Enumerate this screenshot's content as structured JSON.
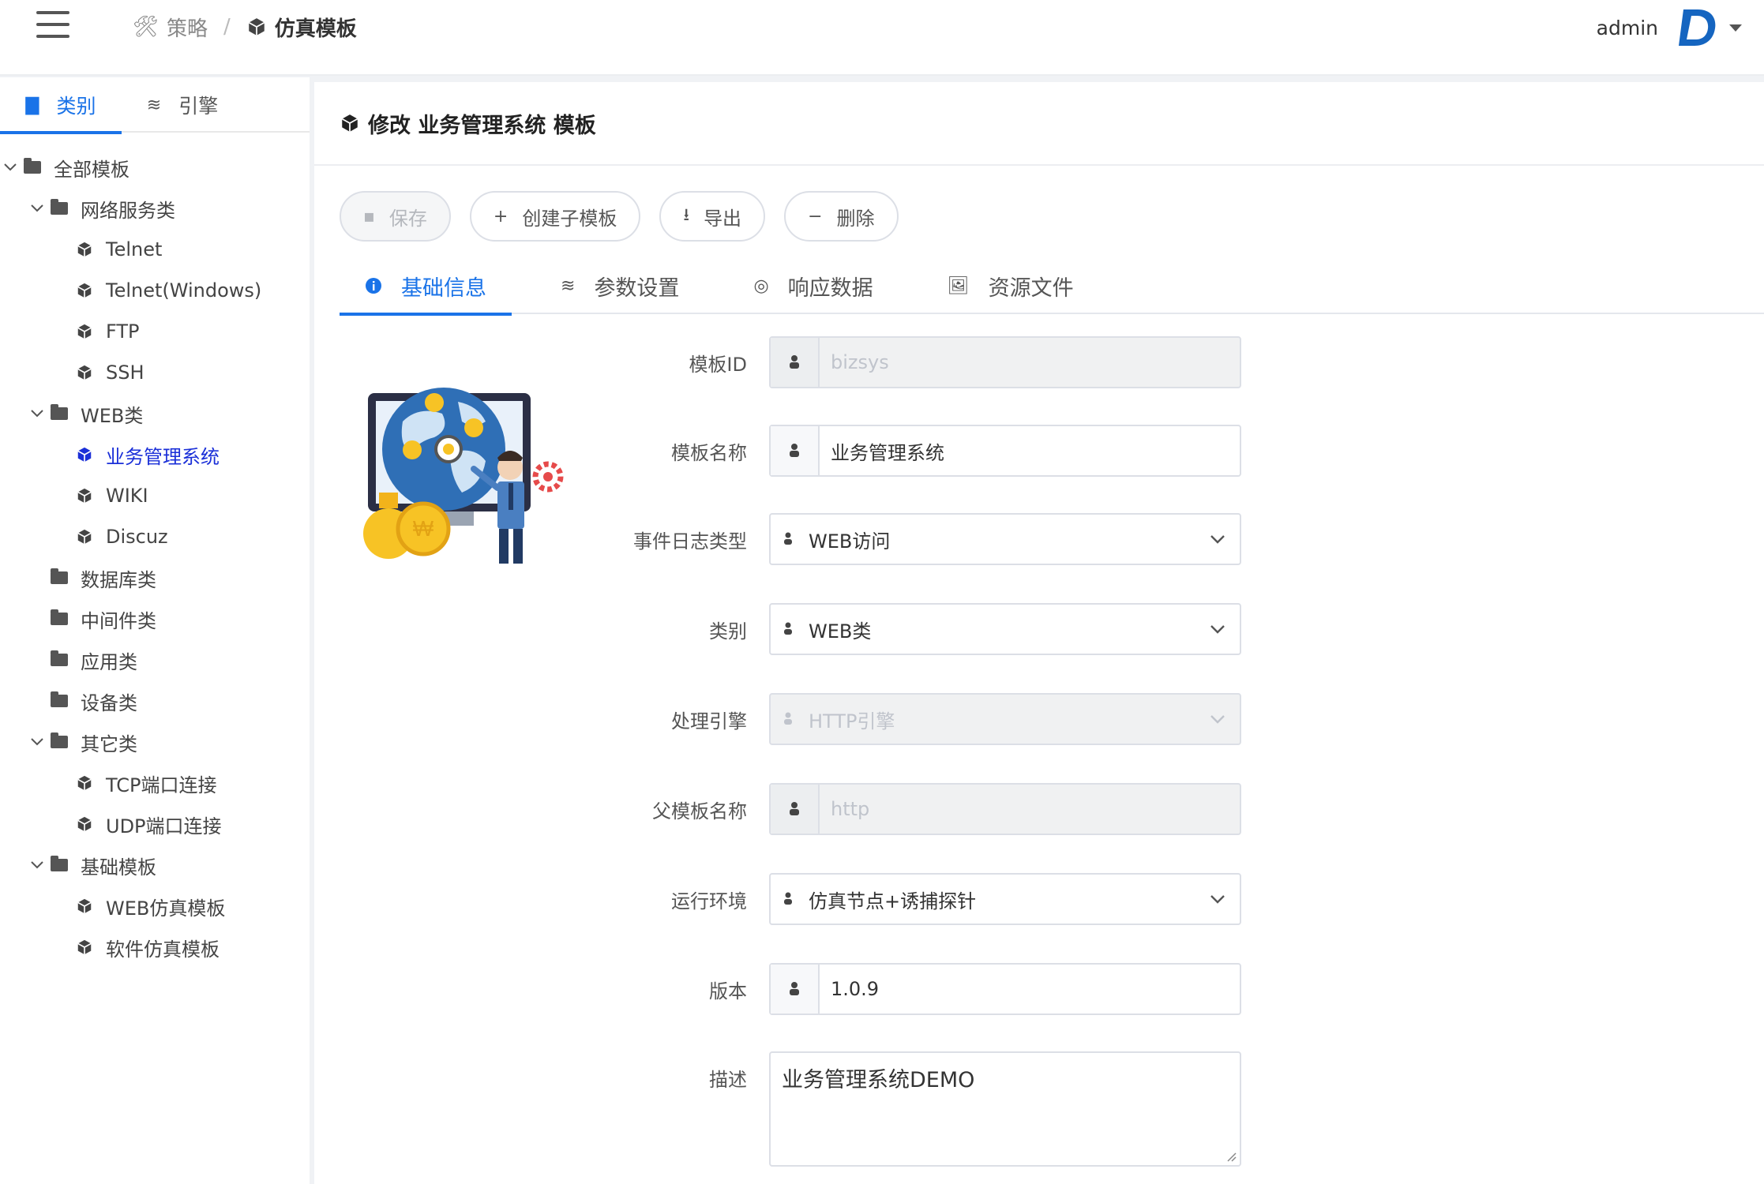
{
  "header": {
    "breadcrumb": [
      {
        "label": "策略",
        "icon": "tools-icon"
      },
      {
        "label": "仿真模板",
        "icon": "cube-icon"
      }
    ],
    "breadcrumb_separator": "/",
    "username": "admin"
  },
  "sidebar": {
    "tabs": [
      {
        "label": "类别",
        "icon": "folder-icon",
        "active": true
      },
      {
        "label": "引擎",
        "icon": "layers-icon",
        "active": false
      }
    ],
    "tree": [
      {
        "label": "全部模板",
        "type": "folder",
        "level": 0,
        "expanded": true
      },
      {
        "label": "网络服务类",
        "type": "folder",
        "level": 1,
        "expanded": true
      },
      {
        "label": "Telnet",
        "type": "item",
        "level": 2
      },
      {
        "label": "Telnet(Windows)",
        "type": "item",
        "level": 2
      },
      {
        "label": "FTP",
        "type": "item",
        "level": 2
      },
      {
        "label": "SSH",
        "type": "item",
        "level": 2
      },
      {
        "label": "WEB类",
        "type": "folder",
        "level": 1,
        "expanded": true
      },
      {
        "label": "业务管理系统",
        "type": "item",
        "level": 2,
        "selected": true
      },
      {
        "label": "WIKI",
        "type": "item",
        "level": 2
      },
      {
        "label": "Discuz",
        "type": "item",
        "level": 2
      },
      {
        "label": "数据库类",
        "type": "folder",
        "level": 1,
        "expanded": false
      },
      {
        "label": "中间件类",
        "type": "folder",
        "level": 1,
        "expanded": false
      },
      {
        "label": "应用类",
        "type": "folder",
        "level": 1,
        "expanded": false
      },
      {
        "label": "设备类",
        "type": "folder",
        "level": 1,
        "expanded": false
      },
      {
        "label": "其它类",
        "type": "folder",
        "level": 1,
        "expanded": true
      },
      {
        "label": "TCP端口连接",
        "type": "item",
        "level": 2
      },
      {
        "label": "UDP端口连接",
        "type": "item",
        "level": 2
      },
      {
        "label": "基础模板",
        "type": "folder",
        "level": 1,
        "expanded": true
      },
      {
        "label": "WEB仿真模板",
        "type": "item",
        "level": 2
      },
      {
        "label": "软件仿真模板",
        "type": "item",
        "level": 2
      }
    ]
  },
  "main": {
    "title": "修改 业务管理系统 模板",
    "toolbar": {
      "save": "保存",
      "create_child": "创建子模板",
      "export": "导出",
      "delete": "删除"
    },
    "tabs": [
      {
        "label": "基础信息",
        "icon": "info-icon",
        "active": true
      },
      {
        "label": "参数设置",
        "icon": "layers-icon",
        "active": false
      },
      {
        "label": "响应数据",
        "icon": "target-icon",
        "active": false
      },
      {
        "label": "资源文件",
        "icon": "image-icon",
        "active": false
      }
    ],
    "form": {
      "template_id": {
        "label": "模板ID",
        "value": "bizsys"
      },
      "template_name": {
        "label": "模板名称",
        "value": "业务管理系统"
      },
      "event_log_type": {
        "label": "事件日志类型",
        "value": "WEB访问"
      },
      "category": {
        "label": "类别",
        "value": "WEB类"
      },
      "engine": {
        "label": "处理引擎",
        "value": "HTTP引擎"
      },
      "parent_template": {
        "label": "父模板名称",
        "value": "http"
      },
      "runtime_env": {
        "label": "运行环境",
        "value": "仿真节点+诱捕探针"
      },
      "version": {
        "label": "版本",
        "value": "1.0.9"
      },
      "description": {
        "label": "描述",
        "value": "业务管理系统DEMO"
      }
    }
  },
  "colors": {
    "accent": "#1a73e8",
    "selected_tree": "#1a2fd8",
    "border": "#dcdfe6",
    "disabled_bg": "#f0f1f2"
  }
}
